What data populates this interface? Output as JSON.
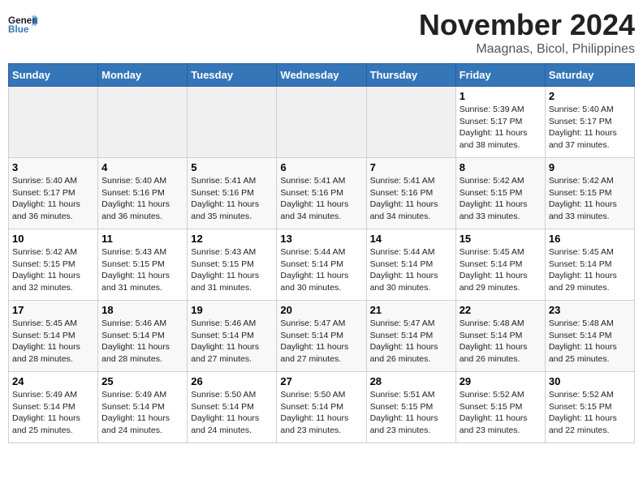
{
  "logo": {
    "line1": "General",
    "line2": "Blue"
  },
  "title": "November 2024",
  "subtitle": "Maagnas, Bicol, Philippines",
  "days_of_week": [
    "Sunday",
    "Monday",
    "Tuesday",
    "Wednesday",
    "Thursday",
    "Friday",
    "Saturday"
  ],
  "weeks": [
    [
      {
        "day": "",
        "info": ""
      },
      {
        "day": "",
        "info": ""
      },
      {
        "day": "",
        "info": ""
      },
      {
        "day": "",
        "info": ""
      },
      {
        "day": "",
        "info": ""
      },
      {
        "day": "1",
        "info": "Sunrise: 5:39 AM\nSunset: 5:17 PM\nDaylight: 11 hours\nand 38 minutes."
      },
      {
        "day": "2",
        "info": "Sunrise: 5:40 AM\nSunset: 5:17 PM\nDaylight: 11 hours\nand 37 minutes."
      }
    ],
    [
      {
        "day": "3",
        "info": "Sunrise: 5:40 AM\nSunset: 5:17 PM\nDaylight: 11 hours\nand 36 minutes."
      },
      {
        "day": "4",
        "info": "Sunrise: 5:40 AM\nSunset: 5:16 PM\nDaylight: 11 hours\nand 36 minutes."
      },
      {
        "day": "5",
        "info": "Sunrise: 5:41 AM\nSunset: 5:16 PM\nDaylight: 11 hours\nand 35 minutes."
      },
      {
        "day": "6",
        "info": "Sunrise: 5:41 AM\nSunset: 5:16 PM\nDaylight: 11 hours\nand 34 minutes."
      },
      {
        "day": "7",
        "info": "Sunrise: 5:41 AM\nSunset: 5:16 PM\nDaylight: 11 hours\nand 34 minutes."
      },
      {
        "day": "8",
        "info": "Sunrise: 5:42 AM\nSunset: 5:15 PM\nDaylight: 11 hours\nand 33 minutes."
      },
      {
        "day": "9",
        "info": "Sunrise: 5:42 AM\nSunset: 5:15 PM\nDaylight: 11 hours\nand 33 minutes."
      }
    ],
    [
      {
        "day": "10",
        "info": "Sunrise: 5:42 AM\nSunset: 5:15 PM\nDaylight: 11 hours\nand 32 minutes."
      },
      {
        "day": "11",
        "info": "Sunrise: 5:43 AM\nSunset: 5:15 PM\nDaylight: 11 hours\nand 31 minutes."
      },
      {
        "day": "12",
        "info": "Sunrise: 5:43 AM\nSunset: 5:15 PM\nDaylight: 11 hours\nand 31 minutes."
      },
      {
        "day": "13",
        "info": "Sunrise: 5:44 AM\nSunset: 5:14 PM\nDaylight: 11 hours\nand 30 minutes."
      },
      {
        "day": "14",
        "info": "Sunrise: 5:44 AM\nSunset: 5:14 PM\nDaylight: 11 hours\nand 30 minutes."
      },
      {
        "day": "15",
        "info": "Sunrise: 5:45 AM\nSunset: 5:14 PM\nDaylight: 11 hours\nand 29 minutes."
      },
      {
        "day": "16",
        "info": "Sunrise: 5:45 AM\nSunset: 5:14 PM\nDaylight: 11 hours\nand 29 minutes."
      }
    ],
    [
      {
        "day": "17",
        "info": "Sunrise: 5:45 AM\nSunset: 5:14 PM\nDaylight: 11 hours\nand 28 minutes."
      },
      {
        "day": "18",
        "info": "Sunrise: 5:46 AM\nSunset: 5:14 PM\nDaylight: 11 hours\nand 28 minutes."
      },
      {
        "day": "19",
        "info": "Sunrise: 5:46 AM\nSunset: 5:14 PM\nDaylight: 11 hours\nand 27 minutes."
      },
      {
        "day": "20",
        "info": "Sunrise: 5:47 AM\nSunset: 5:14 PM\nDaylight: 11 hours\nand 27 minutes."
      },
      {
        "day": "21",
        "info": "Sunrise: 5:47 AM\nSunset: 5:14 PM\nDaylight: 11 hours\nand 26 minutes."
      },
      {
        "day": "22",
        "info": "Sunrise: 5:48 AM\nSunset: 5:14 PM\nDaylight: 11 hours\nand 26 minutes."
      },
      {
        "day": "23",
        "info": "Sunrise: 5:48 AM\nSunset: 5:14 PM\nDaylight: 11 hours\nand 25 minutes."
      }
    ],
    [
      {
        "day": "24",
        "info": "Sunrise: 5:49 AM\nSunset: 5:14 PM\nDaylight: 11 hours\nand 25 minutes."
      },
      {
        "day": "25",
        "info": "Sunrise: 5:49 AM\nSunset: 5:14 PM\nDaylight: 11 hours\nand 24 minutes."
      },
      {
        "day": "26",
        "info": "Sunrise: 5:50 AM\nSunset: 5:14 PM\nDaylight: 11 hours\nand 24 minutes."
      },
      {
        "day": "27",
        "info": "Sunrise: 5:50 AM\nSunset: 5:14 PM\nDaylight: 11 hours\nand 23 minutes."
      },
      {
        "day": "28",
        "info": "Sunrise: 5:51 AM\nSunset: 5:15 PM\nDaylight: 11 hours\nand 23 minutes."
      },
      {
        "day": "29",
        "info": "Sunrise: 5:52 AM\nSunset: 5:15 PM\nDaylight: 11 hours\nand 23 minutes."
      },
      {
        "day": "30",
        "info": "Sunrise: 5:52 AM\nSunset: 5:15 PM\nDaylight: 11 hours\nand 22 minutes."
      }
    ]
  ]
}
